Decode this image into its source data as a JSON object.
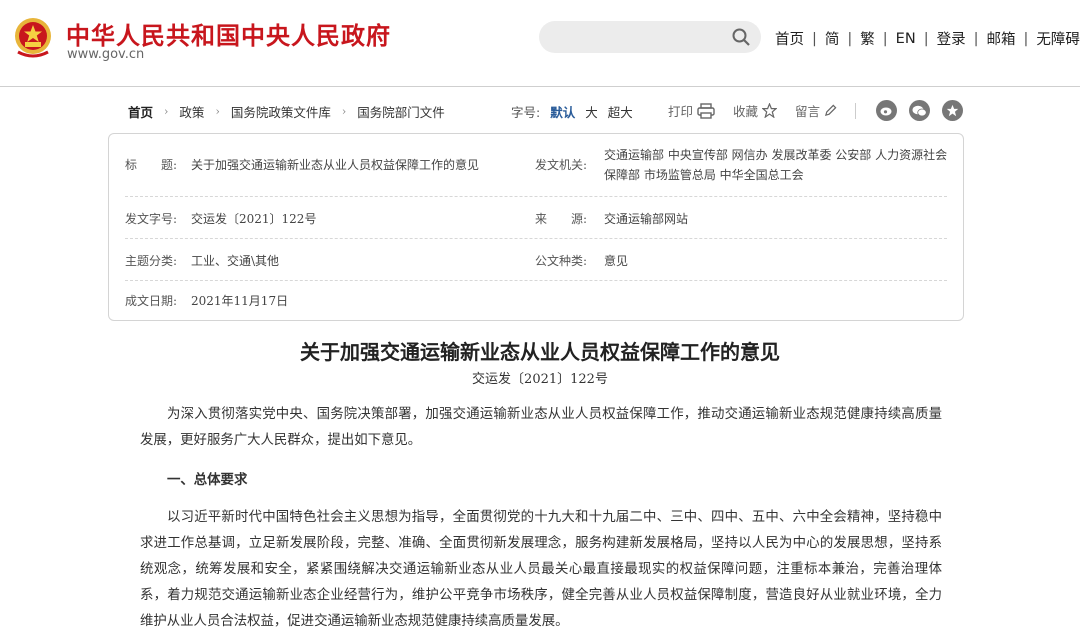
{
  "header": {
    "site_title": "中华人民共和国中央人民政府",
    "site_url": "www.gov.cn",
    "search_placeholder": "",
    "nav": [
      "首页",
      "简",
      "繁",
      "EN",
      "登录",
      "邮箱",
      "无障碍"
    ],
    "nav_separator": "|"
  },
  "breadcrumb": {
    "items": [
      "首页",
      "政策",
      "国务院政策文件库",
      "国务院部门文件"
    ],
    "separator": "›"
  },
  "font_size": {
    "label": "字号:",
    "options": [
      "默认",
      "大",
      "超大"
    ],
    "active_index": 0
  },
  "tools": {
    "print": "打印",
    "favorite": "收藏",
    "comment": "留言"
  },
  "share_icons": [
    "weibo-icon",
    "wechat-icon",
    "star-badge-icon"
  ],
  "info": {
    "title_label": "标　　题:",
    "title_value": "关于加强交通运输新业态从业人员权益保障工作的意见",
    "issuer_label": "发文机关:",
    "issuer_value": "交通运输部  中央宣传部  网信办  发展改革委  公安部  人力资源社会保障部  市场监管总局  中华全国总工会",
    "docno_label": "发文字号:",
    "docno_value": "交运发〔2021〕122号",
    "source_label": "来　　源:",
    "source_value": "交通运输部网站",
    "topic_label": "主题分类:",
    "topic_value": "工业、交通\\其他",
    "doctype_label": "公文种类:",
    "doctype_value": "意见",
    "date_label": "成文日期:",
    "date_value": "2021年11月17日"
  },
  "document": {
    "title": "关于加强交通运输新业态从业人员权益保障工作的意见",
    "number": "交运发〔2021〕122号",
    "para1": "为深入贯彻落实党中央、国务院决策部署，加强交通运输新业态从业人员权益保障工作，推动交通运输新业态规范健康持续高质量发展，更好服务广大人民群众，提出如下意见。",
    "heading1": "一、总体要求",
    "para2": "以习近平新时代中国特色社会主义思想为指导，全面贯彻党的十九大和十九届二中、三中、四中、五中、六中全会精神，坚持稳中求进工作总基调，立足新发展阶段，完整、准确、全面贯彻新发展理念，服务构建新发展格局，坚持以人民为中心的发展思想，坚持系统观念，统筹发展和安全，紧紧围绕解决交通运输新业态从业人员最关心最直接最现实的权益保障问题，注重标本兼治，完善治理体系，着力规范交通运输新业态企业经营行为，维护公平竞争市场秩序，健全完善从业人员权益保障制度，营造良好从业就业环境，全力维护从业人员合法权益，促进交通运输新业态规范健康持续高质量发展。"
  },
  "colors": {
    "brand_red": "#c8161d",
    "active_blue": "#2a5c9a"
  }
}
